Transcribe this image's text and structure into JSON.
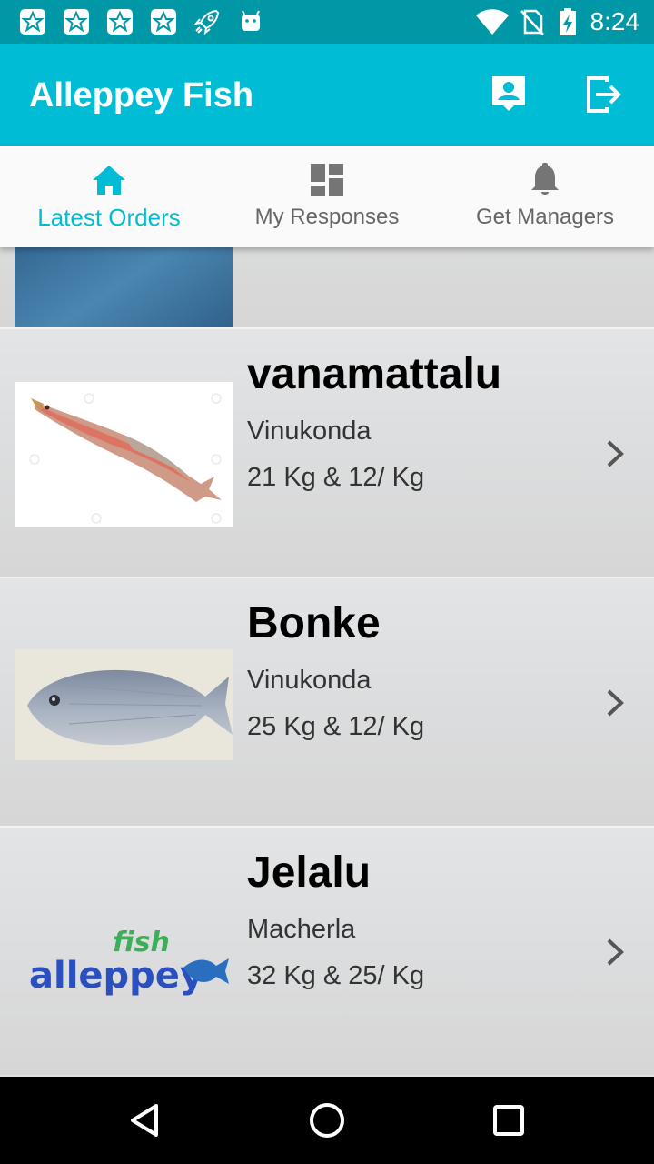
{
  "status_bar": {
    "time": "8:24",
    "notification_icons": [
      "star-notification-icon",
      "star-notification-icon",
      "star-notification-icon",
      "star-notification-icon",
      "rocket-notification-icon",
      "android-notification-icon"
    ],
    "system_icons": [
      "wifi-icon",
      "no-sim-icon",
      "battery-charging-icon"
    ]
  },
  "app_bar": {
    "title": "Alleppey Fish",
    "actions": [
      "profile-icon",
      "logout-icon"
    ]
  },
  "tabs": [
    {
      "label": "Latest Orders",
      "icon": "home-icon",
      "active": true
    },
    {
      "label": "My Responses",
      "icon": "dashboard-icon",
      "active": false
    },
    {
      "label": "Get Managers",
      "icon": "bell-icon",
      "active": false
    }
  ],
  "orders": [
    {
      "name": "vanamattalu",
      "location": "Vinukonda",
      "quantity": "21 Kg & 12/ Kg",
      "image": "fish-photo"
    },
    {
      "name": "Bonke",
      "location": "Vinukonda",
      "quantity": "25 Kg & 12/ Kg",
      "image": "fish-photo"
    },
    {
      "name": "Jelalu",
      "location": "Macherla",
      "quantity": "32 Kg & 25/ Kg",
      "image": "alleppey-fish-logo",
      "logo_text": "alleppey fish"
    }
  ],
  "nav_bar": {
    "buttons": [
      "back-icon",
      "home-circle-icon",
      "recents-icon"
    ]
  },
  "colors": {
    "primary": "#00bcd4",
    "primary_dark": "#0097a7",
    "accent_text": "#00bcd4"
  }
}
